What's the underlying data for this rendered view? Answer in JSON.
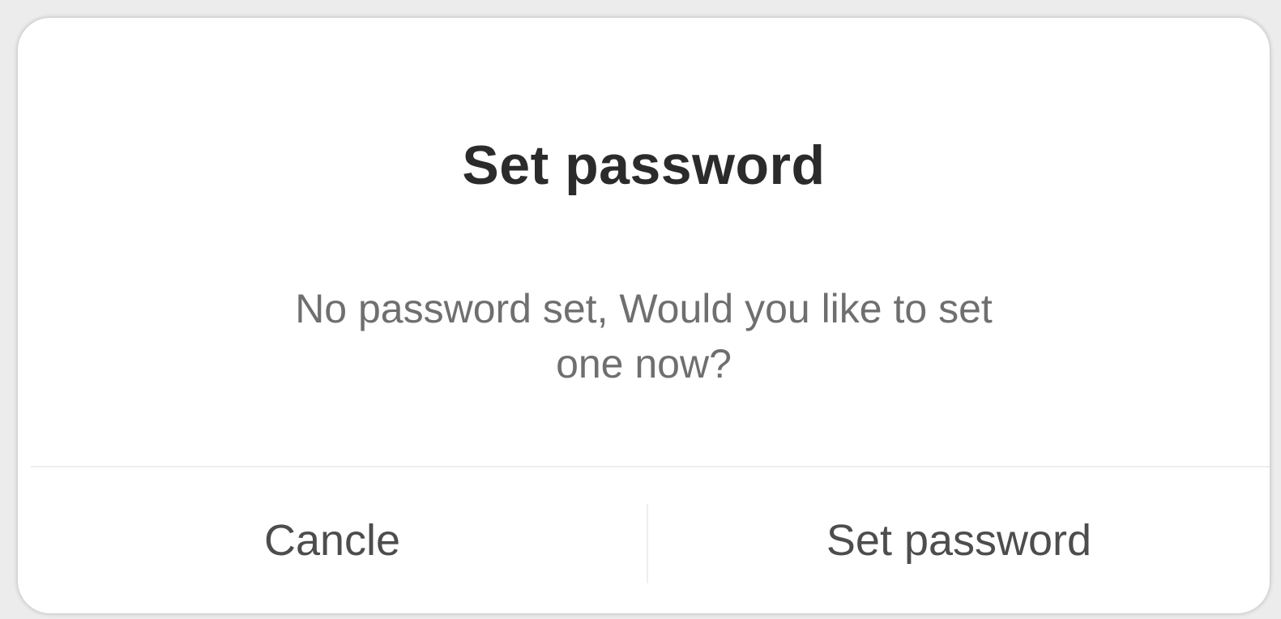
{
  "dialog": {
    "title": "Set password",
    "message": "No password set, Would you like to set one now?",
    "buttons": {
      "cancel_label": "Cancle",
      "confirm_label": "Set password"
    }
  }
}
